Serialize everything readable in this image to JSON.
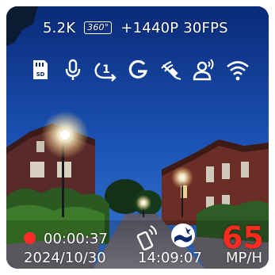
{
  "hud": {
    "resolution_left": "5.2K",
    "badge": "360°",
    "resolution_right": "+1440P 30FPS"
  },
  "icons": [
    "sd-card-icon",
    "microphone-icon",
    "loop-recording-1-icon",
    "g-sensor-icon",
    "gps-satellite-icon",
    "voice-control-icon",
    "wifi-icon"
  ],
  "recording": {
    "elapsed": "00:00:37",
    "indicator_color": "#ff2a2a"
  },
  "timestamp": {
    "date": "2024/10/30",
    "time": "14:09:07"
  },
  "speed": {
    "value": "65",
    "unit": "MP/H",
    "color": "#ff2a1f"
  },
  "status_icons": [
    "phone-connection-icon",
    "parking-mode-icon"
  ]
}
